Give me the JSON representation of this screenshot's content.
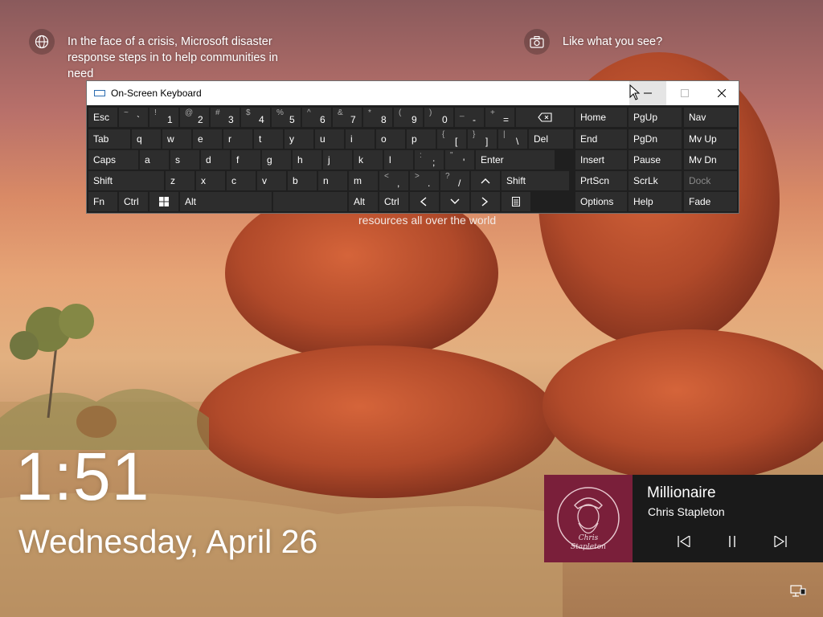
{
  "spotlight": {
    "info_text": "In the face of a crisis, Microsoft disaster response steps in to help communities in need",
    "like_text": "Like what you see?",
    "caption_partial": "resources all over the world"
  },
  "osk": {
    "title": "On-Screen Keyboard",
    "rows": [
      [
        {
          "l": "Esc"
        },
        {
          "l": "` ",
          "s": "~"
        },
        {
          "l": "1",
          "s": "!"
        },
        {
          "l": "2",
          "s": "@"
        },
        {
          "l": "3",
          "s": "#"
        },
        {
          "l": "4",
          "s": "$"
        },
        {
          "l": "5",
          "s": "%"
        },
        {
          "l": "6",
          "s": "^"
        },
        {
          "l": "7",
          "s": "&"
        },
        {
          "l": "8",
          "s": "*"
        },
        {
          "l": "9",
          "s": "("
        },
        {
          "l": "0",
          "s": ")"
        },
        {
          "l": "-",
          "s": "_"
        },
        {
          "l": "=",
          "s": "+"
        },
        {
          "l": "⌫"
        }
      ],
      [
        {
          "l": "Tab"
        },
        {
          "l": "q"
        },
        {
          "l": "w"
        },
        {
          "l": "e"
        },
        {
          "l": "r"
        },
        {
          "l": "t"
        },
        {
          "l": "y"
        },
        {
          "l": "u"
        },
        {
          "l": "i"
        },
        {
          "l": "o"
        },
        {
          "l": "p"
        },
        {
          "l": "[",
          "s": "{"
        },
        {
          "l": "]",
          "s": "}"
        },
        {
          "l": "\\",
          "s": "|"
        },
        {
          "l": "Del"
        }
      ],
      [
        {
          "l": "Caps"
        },
        {
          "l": "a"
        },
        {
          "l": "s"
        },
        {
          "l": "d"
        },
        {
          "l": "f"
        },
        {
          "l": "g"
        },
        {
          "l": "h"
        },
        {
          "l": "j"
        },
        {
          "l": "k"
        },
        {
          "l": "l"
        },
        {
          "l": ";",
          "s": ":"
        },
        {
          "l": "'",
          "s": "\""
        },
        {
          "l": "Enter"
        }
      ],
      [
        {
          "l": "Shift"
        },
        {
          "l": "z"
        },
        {
          "l": "x"
        },
        {
          "l": "c"
        },
        {
          "l": "v"
        },
        {
          "l": "b"
        },
        {
          "l": "n"
        },
        {
          "l": "m"
        },
        {
          "l": ",",
          "s": "<"
        },
        {
          "l": ".",
          "s": ">"
        },
        {
          "l": "/",
          "s": "?"
        },
        {
          "l": "^"
        },
        {
          "l": "Shift"
        }
      ],
      [
        {
          "l": "Fn"
        },
        {
          "l": "Ctrl"
        },
        {
          "l": "win"
        },
        {
          "l": "Alt"
        },
        {
          "l": ""
        },
        {
          "l": "Alt"
        },
        {
          "l": "Ctrl"
        },
        {
          "l": "<"
        },
        {
          "l": "v"
        },
        {
          "l": ">"
        },
        {
          "l": "menu"
        }
      ]
    ],
    "nav_keys": [
      [
        "Home",
        "PgUp",
        "Nav"
      ],
      [
        "End",
        "PgDn",
        "Mv Up"
      ],
      [
        "Insert",
        "Pause",
        "Mv Dn"
      ],
      [
        "PrtScn",
        "ScrLk",
        "Dock"
      ],
      [
        "Options",
        "Help",
        "Fade"
      ]
    ]
  },
  "lock": {
    "time": "1:51",
    "date": "Wednesday, April 26"
  },
  "media": {
    "song": "Millionaire",
    "artist": "Chris Stapleton",
    "album_text": "Chris Stapleton"
  }
}
